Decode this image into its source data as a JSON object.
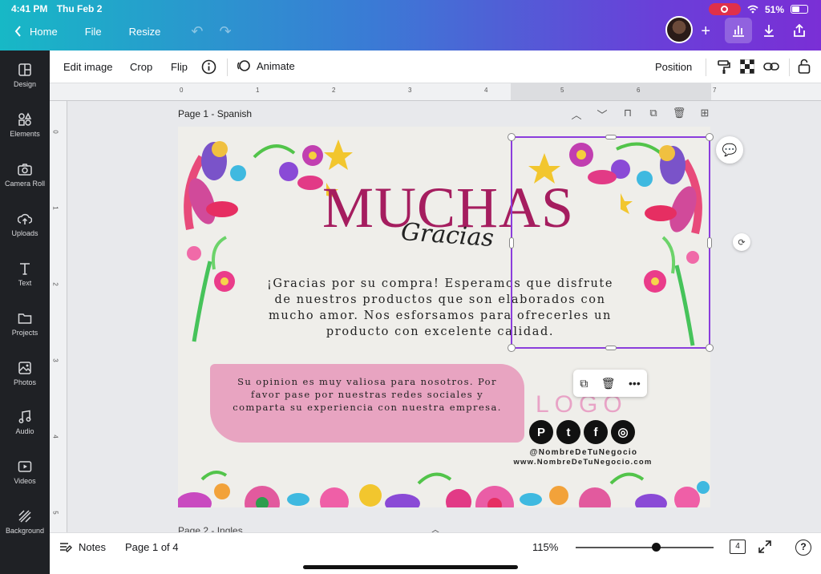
{
  "status_bar": {
    "time": "4:41 PM",
    "date": "Thu Feb 2",
    "battery": "51%"
  },
  "top_nav": {
    "home": "Home",
    "file": "File",
    "resize": "Resize"
  },
  "sidebar": {
    "items": [
      {
        "label": "Design",
        "icon": "design-icon"
      },
      {
        "label": "Elements",
        "icon": "elements-icon"
      },
      {
        "label": "Camera Roll",
        "icon": "camera-icon"
      },
      {
        "label": "Uploads",
        "icon": "upload-icon"
      },
      {
        "label": "Text",
        "icon": "text-icon"
      },
      {
        "label": "Projects",
        "icon": "folder-icon"
      },
      {
        "label": "Photos",
        "icon": "photos-icon"
      },
      {
        "label": "Audio",
        "icon": "audio-icon"
      },
      {
        "label": "Videos",
        "icon": "video-icon"
      },
      {
        "label": "Background",
        "icon": "background-icon"
      }
    ]
  },
  "toolbar": {
    "edit_image": "Edit image",
    "crop": "Crop",
    "flip": "Flip",
    "animate": "Animate",
    "position": "Position"
  },
  "ruler": {
    "top": [
      "0",
      "1",
      "2",
      "3",
      "4",
      "5",
      "6",
      "7"
    ],
    "left": [
      "0",
      "1",
      "2",
      "3",
      "4",
      "5"
    ]
  },
  "page": {
    "title": "Page 1 - Spanish",
    "next_title": "Page 2 - Ingles"
  },
  "design": {
    "headline": "MUCHAS",
    "script": "Gracias",
    "body": "¡Gracias por su compra! Esperamos que disfrute de nuestros productos que son elaborados con mucho amor. Nos esforsamos para ofrecerles un producto con excelente calidad.",
    "note": "Su opinion es muy valiosa para nosotros. Por favor pase por nuestras redes sociales y comparta su experiencia con nuestra empresa.",
    "logo": "LOGO",
    "social": [
      "P",
      "t",
      "f",
      "◎"
    ],
    "handle": "@NombreDeTuNegocio",
    "website": "www.NombreDeTuNegocio.com"
  },
  "footer": {
    "notes": "Notes",
    "page_indicator": "Page 1 of 4",
    "zoom": "115%",
    "pages_count": "4",
    "zoom_level": 0.58
  },
  "colors": {
    "accent": "#a51d5f",
    "selection": "#8b3ddc",
    "brush": "#e79dbd",
    "logo": "#e8a3c6"
  }
}
